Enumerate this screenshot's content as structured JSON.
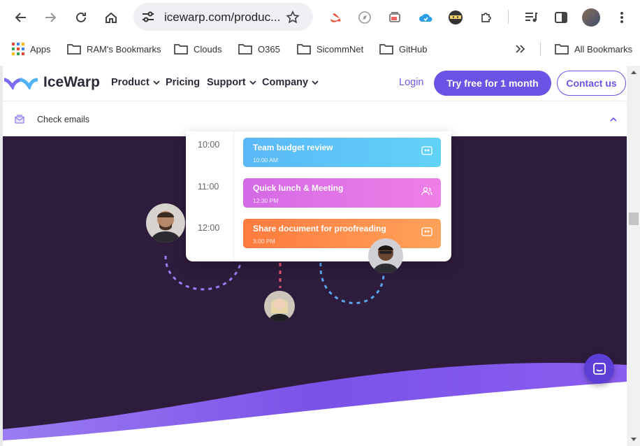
{
  "browser": {
    "url": "icewarp.com/produc...",
    "bookmarks": [
      {
        "label": "Apps",
        "icon": "apps-grid-icon"
      },
      {
        "label": "RAM's Bookmarks",
        "icon": "folder-icon"
      },
      {
        "label": "Clouds",
        "icon": "folder-icon"
      },
      {
        "label": "O365",
        "icon": "folder-icon"
      },
      {
        "label": "SicommNet",
        "icon": "folder-icon"
      },
      {
        "label": "GitHub",
        "icon": "folder-icon"
      }
    ],
    "all_bookmarks": "All Bookmarks"
  },
  "site": {
    "logo": "IceWarp",
    "nav": [
      "Product",
      "Pricing",
      "Support",
      "Company"
    ],
    "login": "Login",
    "try_free": "Try free for 1 month",
    "contact": "Contact us",
    "sub_label": "Check emails"
  },
  "calendar": {
    "times": [
      "10:00",
      "11:00",
      "12:00"
    ],
    "events": [
      {
        "title": "Team budget review",
        "time": "10:00 AM",
        "color": "#4fc3f7"
      },
      {
        "title": "Quick lunch & Meeting",
        "time": "12:30 PM",
        "color": "#e27ce6"
      },
      {
        "title": "Share document for proofreading",
        "time": "3:00 PM",
        "color": "#ff8a4c"
      }
    ]
  },
  "colors": {
    "brand": "#6d52e6",
    "hero_bg": "#2e1c3c"
  }
}
